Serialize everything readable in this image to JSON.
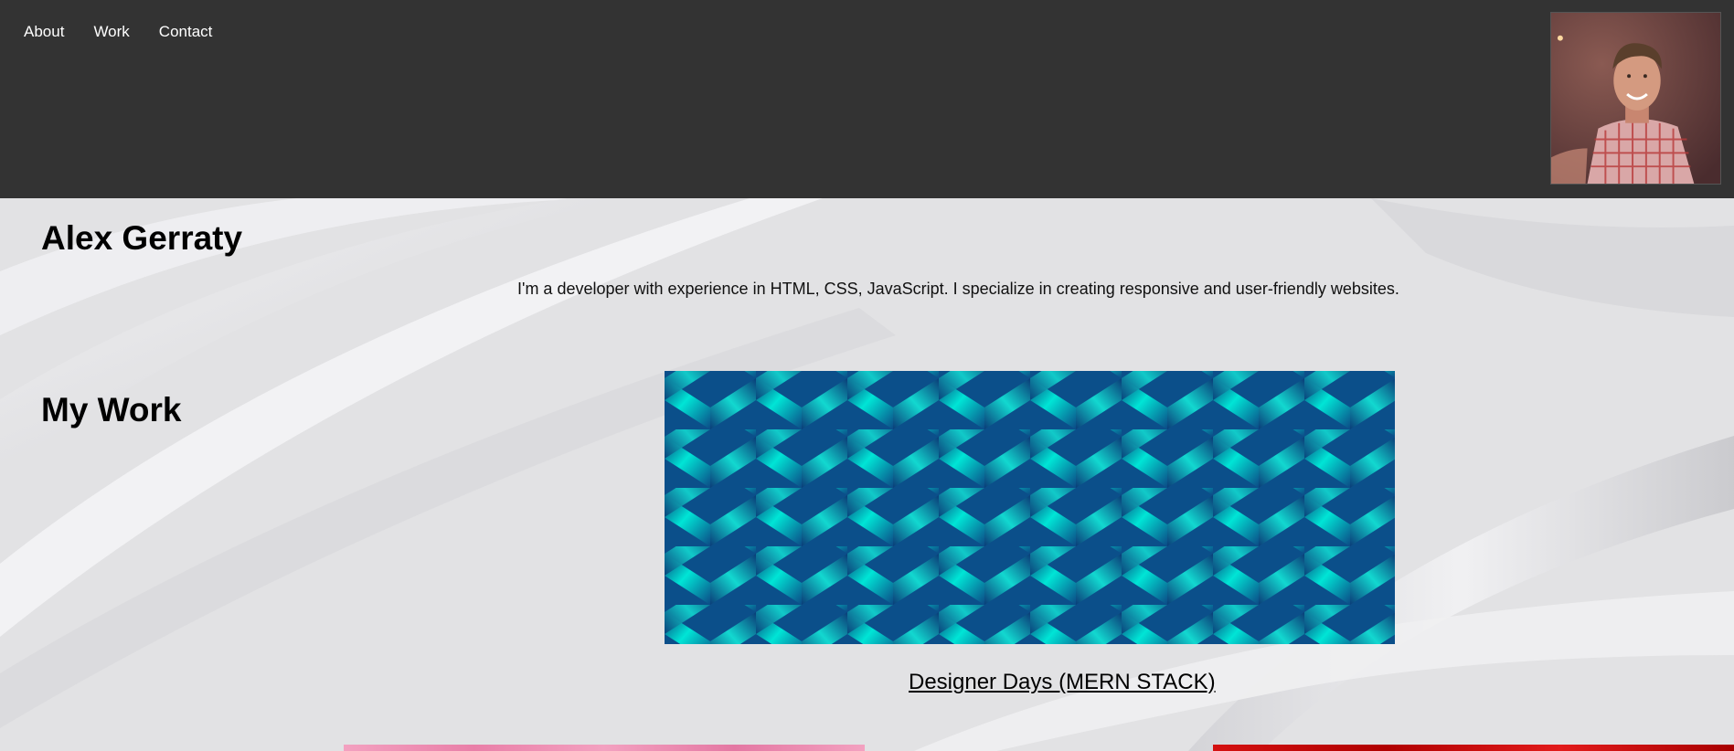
{
  "nav": {
    "items": [
      "About",
      "Work",
      "Contact"
    ]
  },
  "profile": {
    "avatar_icon": "profile-photo"
  },
  "hero": {
    "name": "Alex Gerraty",
    "bio": "I'm a developer with experience in HTML, CSS, JavaScript. I specialize in creating responsive and user-friendly websites."
  },
  "work": {
    "heading": "My Work",
    "projects": [
      {
        "title": "Designer Days (MERN STACK)"
      }
    ]
  },
  "colors": {
    "header_bg": "#333333",
    "nav_text": "#ffffff",
    "page_bg": "#e2e2e4",
    "project_teal": "#00e5d6",
    "project_navy": "#0a3c78"
  }
}
